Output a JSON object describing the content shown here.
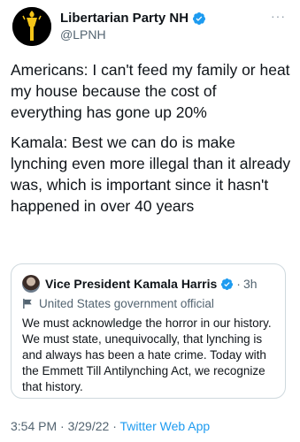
{
  "author": {
    "display_name": "Libertarian Party NH",
    "handle": "@LPNH",
    "verified": true,
    "more_label": "···"
  },
  "tweet": {
    "paragraphs": [
      "Americans: I can't feed my family or heat my house because the cost of everything has gone up 20%",
      "Kamala: Best we can do is make lynching even more illegal than it already was, which is important since it hasn't happened in over 40 years"
    ]
  },
  "quoted_tweet": {
    "display_name": "Vice President Kamala Harris",
    "verified": true,
    "separator": "·",
    "time": "3h",
    "label": "United States government official",
    "text": "We must acknowledge the horror in our history. We must state, unequivocally, that lynching is and always has been a hate crime. Today with the Emmett Till Antilynching Act, we recognize that history."
  },
  "meta": {
    "time": "3:54 PM",
    "sep1": " · ",
    "date": "3/29/22",
    "sep2": " · ",
    "source": "Twitter Web App"
  },
  "colors": {
    "text": "#0f1419",
    "secondary": "#536471",
    "accent": "#1d9bf0",
    "border": "#cfd9de"
  }
}
